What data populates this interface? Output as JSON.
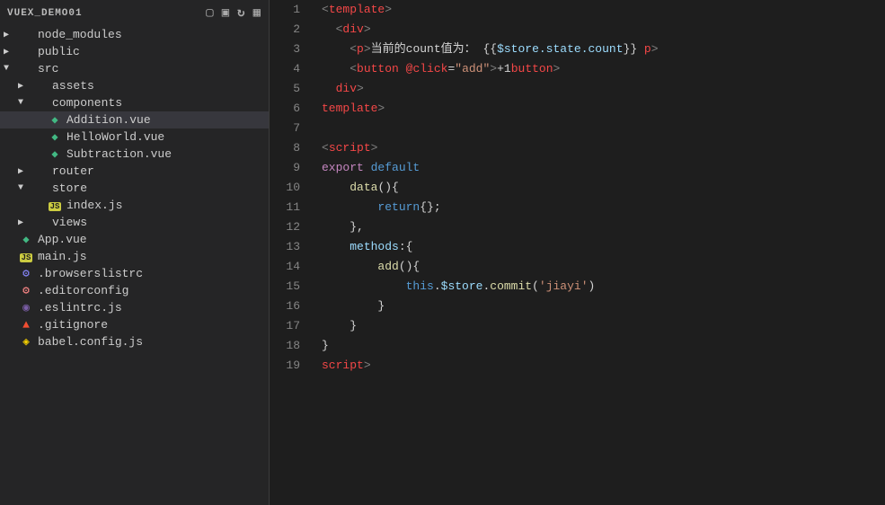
{
  "sidebar": {
    "title": "VUEX_DEMO01",
    "items": [
      {
        "id": "node_modules",
        "label": "node_modules",
        "type": "folder",
        "depth": 0,
        "expanded": false
      },
      {
        "id": "public",
        "label": "public",
        "type": "folder",
        "depth": 0,
        "expanded": false
      },
      {
        "id": "src",
        "label": "src",
        "type": "folder",
        "depth": 0,
        "expanded": true
      },
      {
        "id": "assets",
        "label": "assets",
        "type": "folder",
        "depth": 1,
        "expanded": false
      },
      {
        "id": "components",
        "label": "components",
        "type": "folder",
        "depth": 1,
        "expanded": true
      },
      {
        "id": "Addition.vue",
        "label": "Addition.vue",
        "type": "vue",
        "depth": 2,
        "active": true
      },
      {
        "id": "HelloWorld.vue",
        "label": "HelloWorld.vue",
        "type": "vue",
        "depth": 2
      },
      {
        "id": "Subtraction.vue",
        "label": "Subtraction.vue",
        "type": "vue",
        "depth": 2
      },
      {
        "id": "router",
        "label": "router",
        "type": "folder",
        "depth": 1,
        "expanded": false
      },
      {
        "id": "store",
        "label": "store",
        "type": "folder",
        "depth": 1,
        "expanded": true
      },
      {
        "id": "index.js",
        "label": "index.js",
        "type": "js",
        "depth": 2
      },
      {
        "id": "views",
        "label": "views",
        "type": "folder",
        "depth": 1,
        "expanded": false
      },
      {
        "id": "App.vue",
        "label": "App.vue",
        "type": "vue",
        "depth": 0
      },
      {
        "id": "main.js",
        "label": "main.js",
        "type": "js",
        "depth": 0
      },
      {
        "id": ".browserslistrc",
        "label": ".browserslistrc",
        "type": "config",
        "depth": 0
      },
      {
        "id": ".editorconfig",
        "label": ".editorconfig",
        "type": "config2",
        "depth": 0
      },
      {
        "id": ".eslintrc.js",
        "label": ".eslintrc.js",
        "type": "eslint",
        "depth": 0
      },
      {
        "id": ".gitignore",
        "label": ".gitignore",
        "type": "git",
        "depth": 0
      },
      {
        "id": "babel.config.js",
        "label": "babel.config.js",
        "type": "babel",
        "depth": 0
      }
    ]
  },
  "editor": {
    "lines": [
      {
        "n": 1,
        "tokens": [
          {
            "t": "tag-angle",
            "v": "<"
          },
          {
            "t": "template-tag",
            "v": "template"
          },
          {
            "t": "tag-angle",
            "v": ">"
          }
        ]
      },
      {
        "n": 2,
        "tokens": [
          {
            "t": "plain",
            "v": "  "
          },
          {
            "t": "tag-angle",
            "v": "<"
          },
          {
            "t": "tag",
            "v": "div"
          },
          {
            "t": "tag-angle",
            "v": ">"
          }
        ]
      },
      {
        "n": 3,
        "tokens": [
          {
            "t": "plain",
            "v": "    "
          },
          {
            "t": "tag-angle",
            "v": "<"
          },
          {
            "t": "tag",
            "v": "p"
          },
          {
            "t": "tag-angle",
            "v": ">"
          },
          {
            "t": "chinese",
            "v": "当前的count值为："
          },
          {
            "t": "plain",
            "v": " {{"
          },
          {
            "t": "prop",
            "v": "$store.state.count"
          },
          {
            "t": "plain",
            "v": "}} "
          },
          {
            "t": "tag-angle",
            "v": "</"
          },
          {
            "t": "tag",
            "v": "p"
          },
          {
            "t": "tag-angle",
            "v": ">"
          }
        ]
      },
      {
        "n": 4,
        "tokens": [
          {
            "t": "plain",
            "v": "    "
          },
          {
            "t": "tag-angle",
            "v": "<"
          },
          {
            "t": "tag",
            "v": "button"
          },
          {
            "t": "plain",
            "v": " "
          },
          {
            "t": "event-attr",
            "v": "@click"
          },
          {
            "t": "plain",
            "v": "="
          },
          {
            "t": "attr-value",
            "v": "\"add\""
          },
          {
            "t": "tag-angle",
            "v": ">"
          },
          {
            "t": "plain",
            "v": "+1"
          },
          {
            "t": "tag-angle",
            "v": "</"
          },
          {
            "t": "tag",
            "v": "button"
          },
          {
            "t": "tag-angle",
            "v": ">"
          }
        ]
      },
      {
        "n": 5,
        "tokens": [
          {
            "t": "plain",
            "v": "  "
          },
          {
            "t": "tag-angle",
            "v": "</"
          },
          {
            "t": "tag",
            "v": "div"
          },
          {
            "t": "tag-angle",
            "v": ">"
          }
        ]
      },
      {
        "n": 6,
        "tokens": [
          {
            "t": "tag-angle",
            "v": "</"
          },
          {
            "t": "template-tag",
            "v": "template"
          },
          {
            "t": "tag-angle",
            "v": ">"
          }
        ]
      },
      {
        "n": 7,
        "tokens": []
      },
      {
        "n": 8,
        "tokens": [
          {
            "t": "tag-angle",
            "v": "<"
          },
          {
            "t": "script-tag",
            "v": "script"
          },
          {
            "t": "tag-angle",
            "v": ">"
          }
        ]
      },
      {
        "n": 9,
        "tokens": [
          {
            "t": "export-keyword",
            "v": "export"
          },
          {
            "t": "plain",
            "v": " "
          },
          {
            "t": "default-keyword",
            "v": "default"
          },
          {
            "t": "plain",
            "v": " "
          }
        ]
      },
      {
        "n": 10,
        "tokens": [
          {
            "t": "plain",
            "v": "    "
          },
          {
            "t": "method-name",
            "v": "data"
          },
          {
            "t": "plain",
            "v": "(){"
          },
          {
            "t": "plain",
            "v": " "
          }
        ]
      },
      {
        "n": 11,
        "tokens": [
          {
            "t": "plain",
            "v": "        "
          },
          {
            "t": "keyword",
            "v": "return"
          },
          {
            "t": "plain",
            "v": "{};"
          },
          {
            "t": "plain",
            "v": " "
          }
        ]
      },
      {
        "n": 12,
        "tokens": [
          {
            "t": "plain",
            "v": "    },"
          },
          {
            "t": "plain",
            "v": " "
          }
        ]
      },
      {
        "n": 13,
        "tokens": [
          {
            "t": "plain",
            "v": "    "
          },
          {
            "t": "prop",
            "v": "methods"
          },
          {
            "t": "plain",
            "v": ":{"
          },
          {
            "t": "plain",
            "v": " "
          }
        ]
      },
      {
        "n": 14,
        "tokens": [
          {
            "t": "plain",
            "v": "        "
          },
          {
            "t": "method-name",
            "v": "add"
          },
          {
            "t": "plain",
            "v": "(){"
          },
          {
            "t": "plain",
            "v": " "
          }
        ]
      },
      {
        "n": 15,
        "tokens": [
          {
            "t": "plain",
            "v": "            "
          },
          {
            "t": "this-keyword",
            "v": "this"
          },
          {
            "t": "plain",
            "v": "."
          },
          {
            "t": "store-prop",
            "v": "$store"
          },
          {
            "t": "plain",
            "v": "."
          },
          {
            "t": "commit-method",
            "v": "commit"
          },
          {
            "t": "plain",
            "v": "("
          },
          {
            "t": "commit-arg",
            "v": "'jiayi'"
          },
          {
            "t": "plain",
            "v": ")"
          }
        ]
      },
      {
        "n": 16,
        "tokens": [
          {
            "t": "plain",
            "v": "        }"
          }
        ]
      },
      {
        "n": 17,
        "tokens": [
          {
            "t": "plain",
            "v": "    }"
          }
        ]
      },
      {
        "n": 18,
        "tokens": [
          {
            "t": "plain",
            "v": "}"
          }
        ]
      },
      {
        "n": 19,
        "tokens": [
          {
            "t": "tag-angle",
            "v": "</"
          },
          {
            "t": "script-tag",
            "v": "script"
          },
          {
            "t": "tag-angle",
            "v": ">"
          }
        ]
      }
    ]
  }
}
